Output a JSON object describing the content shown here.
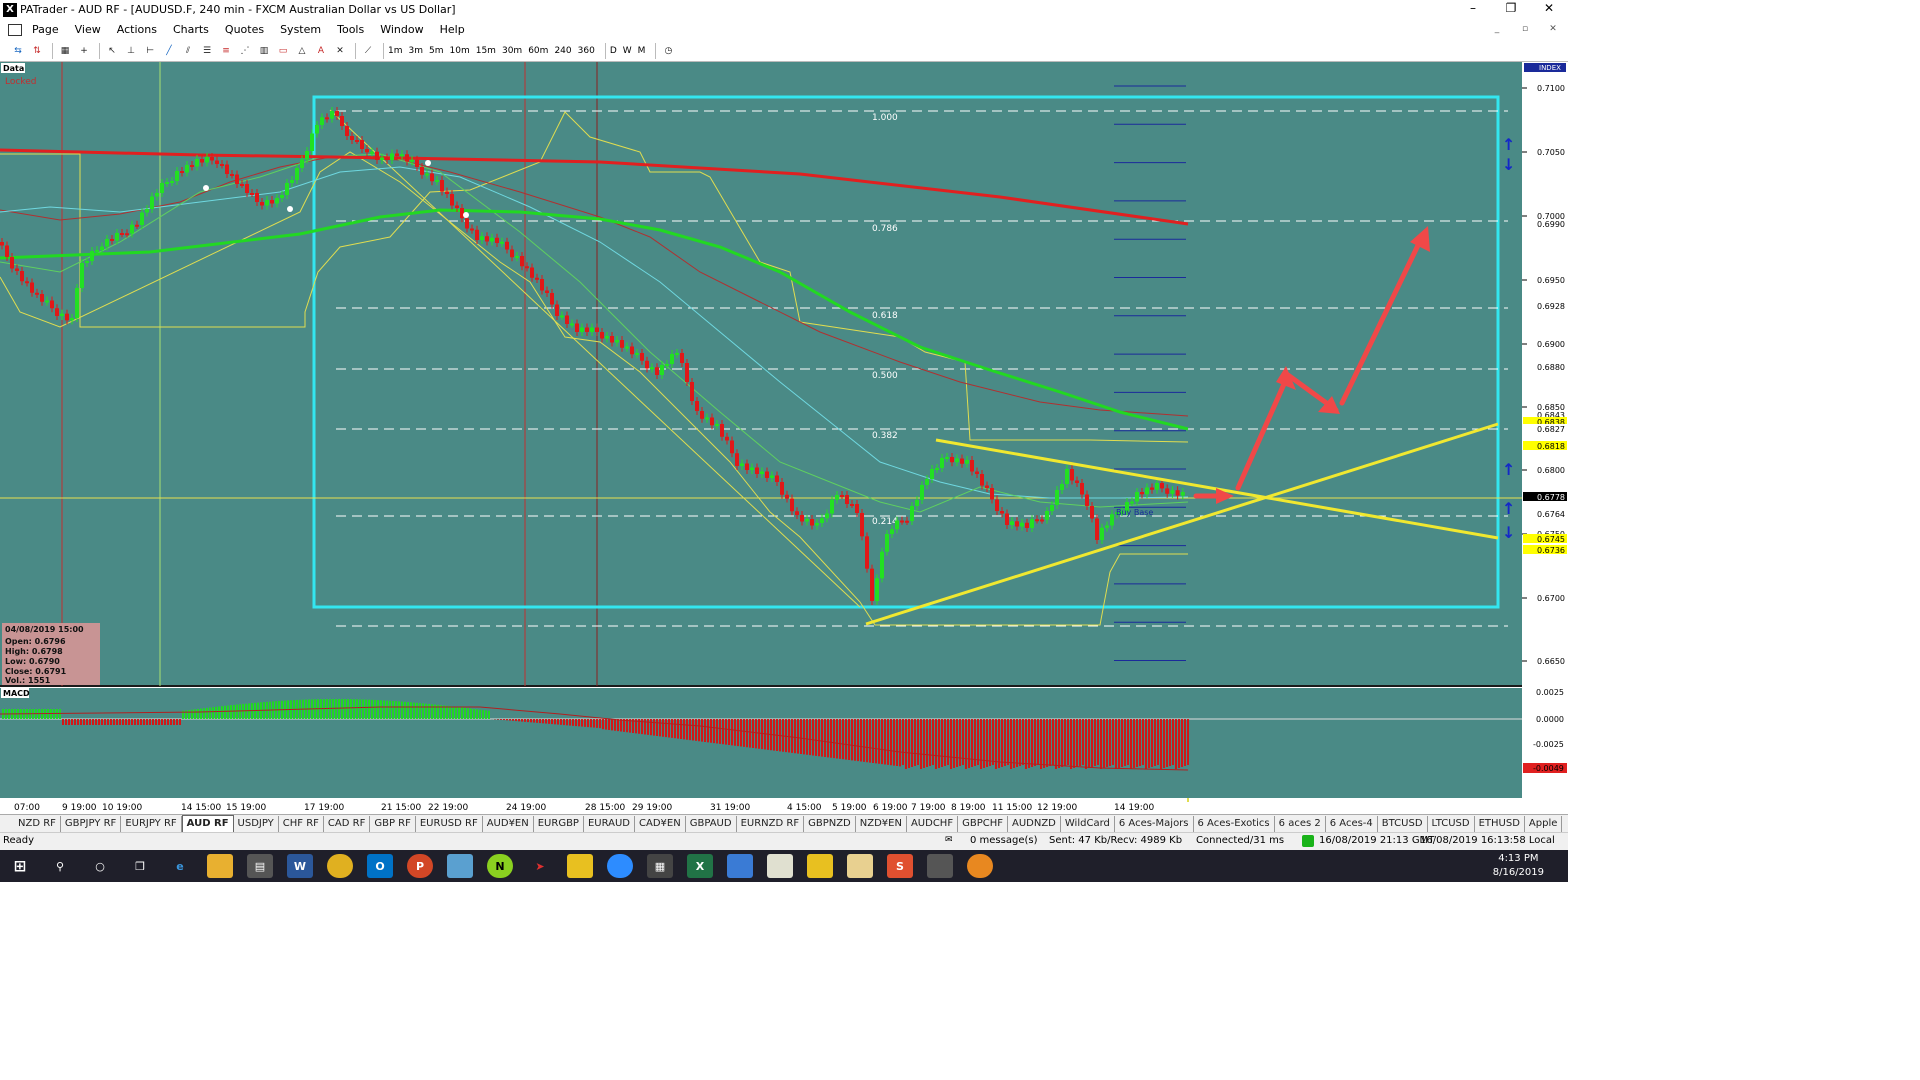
{
  "window": {
    "title": "PATrader - AUD RF - [AUDUSD.F, 240 min - FXCM Australian Dollar vs US Dollar]",
    "app_icon": "X",
    "controls": [
      "–",
      "❐",
      "✕"
    ]
  },
  "menu": [
    "Page",
    "View",
    "Actions",
    "Charts",
    "Quotes",
    "System",
    "Tools",
    "Window",
    "Help"
  ],
  "mdi_controls": [
    "_",
    "▫",
    "✕"
  ],
  "toolbar": {
    "timeframes": [
      "1m",
      "3m",
      "5m",
      "10m",
      "15m",
      "30m",
      "60m",
      "240",
      "360"
    ],
    "periods": [
      "D",
      "W",
      "M"
    ]
  },
  "chart": {
    "bg_color": "#4a8a86",
    "panel_labels": {
      "data": "Data",
      "locked": "Locked",
      "index": "INDEX",
      "macd": "MACD"
    },
    "price_ticks": [
      "0.7100",
      "0.7050",
      "0.7000",
      "0.6950",
      "0.6900",
      "0.6850",
      "0.6800",
      "0.6750",
      "0.6700",
      "0.6650"
    ],
    "price_boxes": [
      {
        "label": "0.6990",
        "color": "#ffffff",
        "text": "#000"
      },
      {
        "label": "0.6928",
        "color": "#ffffff",
        "text": "#000"
      },
      {
        "label": "0.6880",
        "color": "#ffffff",
        "text": "#000"
      },
      {
        "label": "0.6843",
        "color": "#ffffff",
        "text": "#000"
      },
      {
        "label": "0.6838",
        "color": "#ffff00",
        "text": "#000"
      },
      {
        "label": "0.6827",
        "color": "#ffffff",
        "text": "#000"
      },
      {
        "label": "0.6818",
        "color": "#ffff00",
        "text": "#000"
      },
      {
        "label": "0.6778",
        "color": "#000000",
        "text": "#fff"
      },
      {
        "label": "0.6764",
        "color": "#ffffff",
        "text": "#000"
      },
      {
        "label": "0.6745",
        "color": "#ffff00",
        "text": "#000"
      },
      {
        "label": "0.6736",
        "color": "#ffff00",
        "text": "#000"
      }
    ],
    "fib_labels": [
      "1.000",
      "0.786",
      "0.618",
      "0.500",
      "0.382",
      "0.214"
    ],
    "ohlc": {
      "date": "04/08/2019 15:00",
      "open": "Open: 0.6796",
      "high": "High: 0.6798",
      "low": "Low: 0.6790",
      "close": "Close: 0.6791",
      "vol": "Vol.: 1551"
    },
    "macd_ticks": [
      "0.0025",
      "0.0000",
      "-0.0025"
    ],
    "macd_box": "-0.0049",
    "annotation": "Buy Base",
    "time_labels": [
      "07:00",
      "9 19:00",
      "10 19:00",
      "14 15:00",
      "15 19:00",
      "17 19:00",
      "21 15:00",
      "22 19:00",
      "24 19:00",
      "28 15:00",
      "29 19:00",
      "31 19:00",
      "4 15:00",
      "5 19:00",
      "6 19:00",
      "7 19:00",
      "8 19:00",
      "11 15:00",
      "12 19:00",
      "14 19:00"
    ],
    "colors": {
      "ma_red": "#e02020",
      "ma_green": "#22d822",
      "cyan_box": "#33e6f0",
      "trend": "#f0e830",
      "arrow": "#f04848"
    }
  },
  "tabs": [
    "NZD RF",
    "GBPJPY RF",
    "EURJPY RF",
    "AUD RF",
    "USDJPY",
    "CHF RF",
    "CAD RF",
    "GBP RF",
    "EURUSD RF",
    "AUD¥EN",
    "EURGBP",
    "EURAUD",
    "CAD¥EN",
    "GBPAUD",
    "EURNZD RF",
    "GBPNZD",
    "NZD¥EN",
    "AUDCHF",
    "GBPCHF",
    "AUDNZD",
    "WildCard",
    "6 Aces-Majors",
    "6 Aces-Exotics",
    "6 aces 2",
    "6 Aces-4",
    "BTCUSD",
    "LTCUSD",
    "ETHUSD",
    "Apple"
  ],
  "active_tab": "AUD RF",
  "status": {
    "ready": "Ready",
    "messages": "0 message(s)",
    "traffic": "Sent: 47 Kb/Recv: 4989 Kb",
    "connection": "Connected/31 ms",
    "gmt": "16/08/2019 21:13 GMT",
    "local": "16/08/2019 16:13:58 Local"
  },
  "taskbar": {
    "time": "4:13 PM",
    "date": "8/16/2019",
    "icons": [
      "windows-start",
      "search",
      "cortana",
      "task-view",
      "edge",
      "file-explorer",
      "patrader",
      "word",
      "chrome",
      "outlook",
      "powerpoint",
      "app",
      "ninja",
      "app2",
      "app3",
      "zoom",
      "calculator",
      "excel",
      "remote",
      "app4",
      "app5",
      "app6",
      "app7",
      "app8",
      "app9"
    ]
  }
}
